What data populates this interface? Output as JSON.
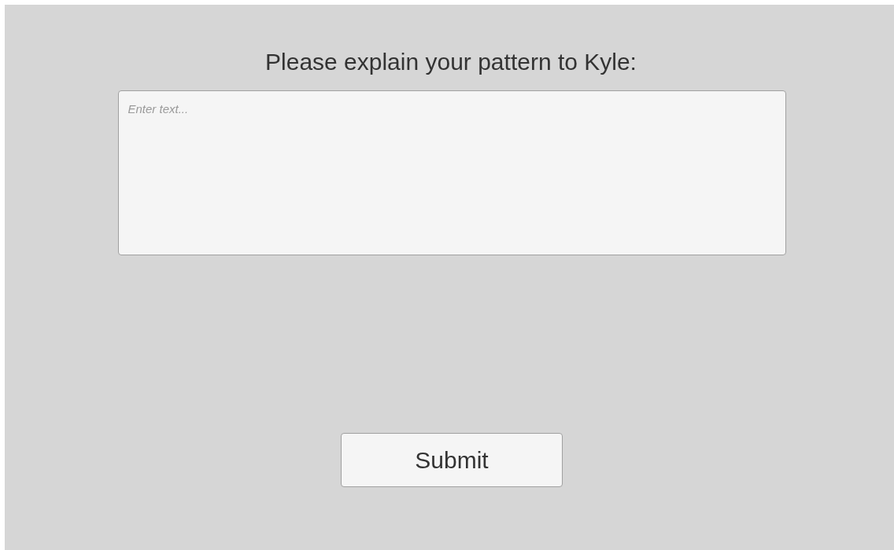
{
  "prompt": "Please explain your pattern to Kyle:",
  "answer": {
    "placeholder": "Enter text..."
  },
  "submit": {
    "label": "Submit"
  }
}
